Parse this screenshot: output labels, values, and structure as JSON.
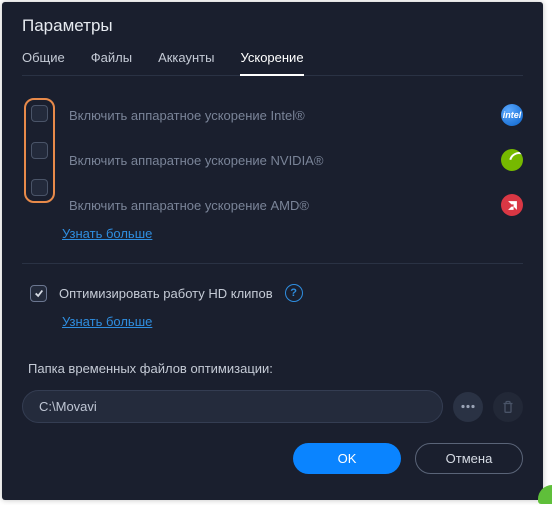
{
  "title": "Параметры",
  "tabs": {
    "general": "Общие",
    "files": "Файлы",
    "accounts": "Аккаунты",
    "acceleration": "Ускорение"
  },
  "hw": {
    "intel": "Включить аппаратное ускорение Intel®",
    "nvidia": "Включить аппаратное ускорение NVIDIA®",
    "amd": "Включить аппаратное ускорение AMD®",
    "learn_more": "Узнать больше",
    "intel_logo_text": "intel"
  },
  "optimize": {
    "label": "Оптимизировать работу HD клипов",
    "learn_more": "Узнать больше"
  },
  "temp_folder": {
    "label": "Папка временных файлов оптимизации:",
    "value": "C:\\Movavi"
  },
  "buttons": {
    "ok": "OK",
    "cancel": "Отмена"
  }
}
